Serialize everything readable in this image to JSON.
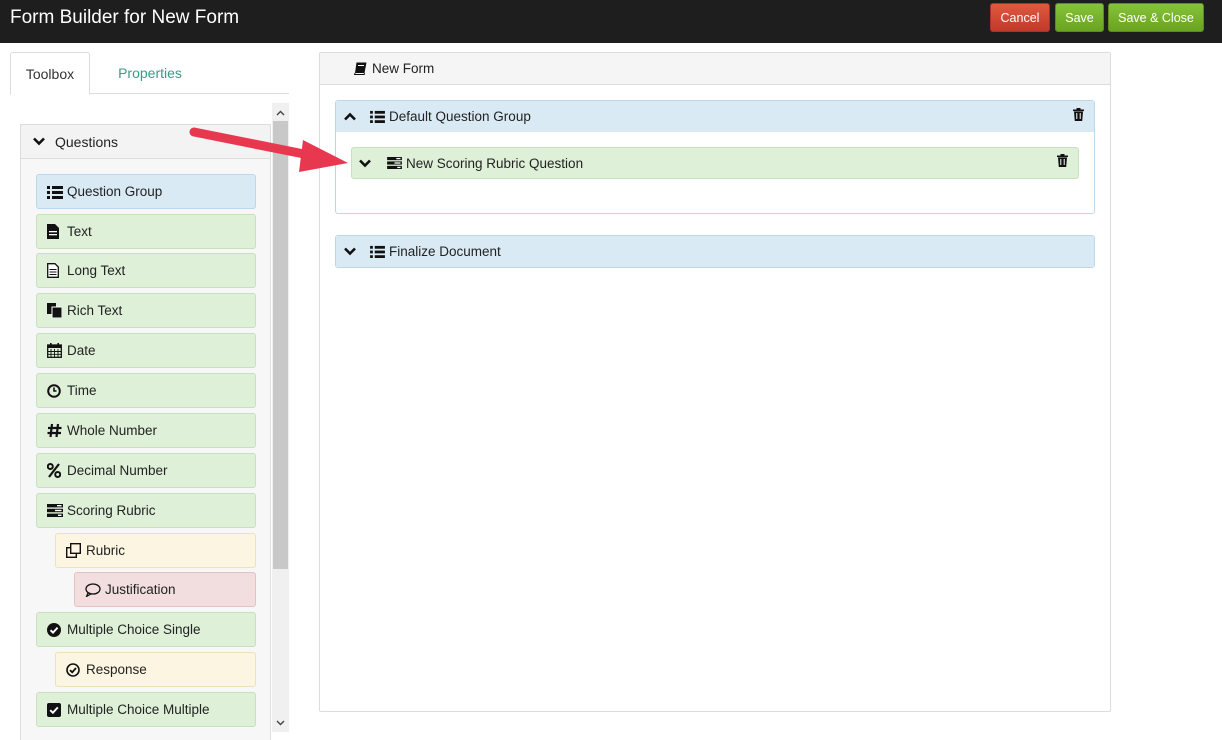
{
  "header": {
    "title": "Form Builder for New Form",
    "cancel_label": "Cancel",
    "save_label": "Save",
    "save_close_label": "Save & Close"
  },
  "tabs": {
    "toolbox": "Toolbox",
    "properties": "Properties"
  },
  "toolbox": {
    "section_label": "Questions",
    "items": [
      {
        "label": "Question Group",
        "icon": "list-icon",
        "color": "blue"
      },
      {
        "label": "Text",
        "icon": "file-icon",
        "color": "green"
      },
      {
        "label": "Long Text",
        "icon": "file-text-icon",
        "color": "green"
      },
      {
        "label": "Rich Text",
        "icon": "copy-icon",
        "color": "green"
      },
      {
        "label": "Date",
        "icon": "calendar-icon",
        "color": "green"
      },
      {
        "label": "Time",
        "icon": "clock-icon",
        "color": "green"
      },
      {
        "label": "Whole Number",
        "icon": "hash-icon",
        "color": "green"
      },
      {
        "label": "Decimal Number",
        "icon": "percent-icon",
        "color": "green"
      },
      {
        "label": "Scoring Rubric",
        "icon": "tasks-icon",
        "color": "green"
      },
      {
        "label": "Rubric",
        "icon": "clone-icon",
        "color": "yellow"
      },
      {
        "label": "Justification",
        "icon": "comment-icon",
        "color": "red"
      },
      {
        "label": "Multiple Choice Single",
        "icon": "check-circle-icon",
        "color": "green"
      },
      {
        "label": "Response",
        "icon": "check-circle-outline-icon",
        "color": "yellow"
      },
      {
        "label": "Multiple Choice Multiple",
        "icon": "check-square-icon",
        "color": "green"
      }
    ]
  },
  "canvas": {
    "form_title": "New Form",
    "groups": [
      {
        "label": "Default Question Group",
        "expanded": true
      },
      {
        "label": "Finalize Document",
        "expanded": false
      }
    ],
    "question_label": "New Scoring Rubric Question"
  },
  "colors": {
    "topbar": "#1e1e1e",
    "cancel": "#c0392b",
    "save": "#6aa320",
    "group_blue": "#d9eaf5",
    "question_green": "#dff0d8",
    "arrow_red": "#e8384f"
  }
}
